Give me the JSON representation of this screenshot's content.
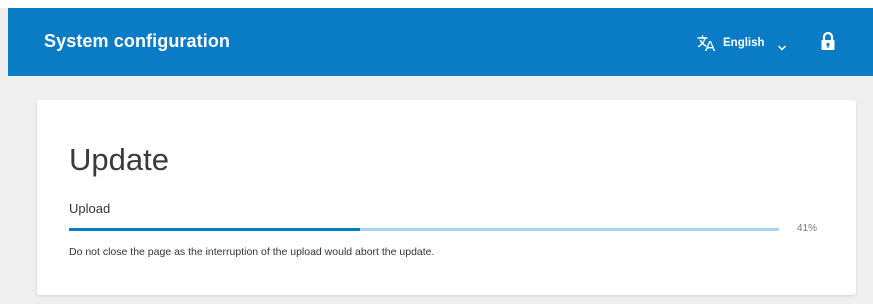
{
  "header": {
    "title": "System configuration",
    "language": {
      "icon": "translate-icon",
      "selected": "English",
      "dropdown_icon": "chevron-down-icon"
    },
    "lock_icon": "lock-icon",
    "background_color": "#0a7cc6"
  },
  "update": {
    "title": "Update",
    "step_label": "Upload",
    "progress": {
      "percent": 41,
      "percent_label": "41%",
      "fill_color": "#0a7cc6",
      "track_color": "#a8d3f1"
    },
    "warning": "Do not close the page as the interruption of the upload would abort the update."
  }
}
